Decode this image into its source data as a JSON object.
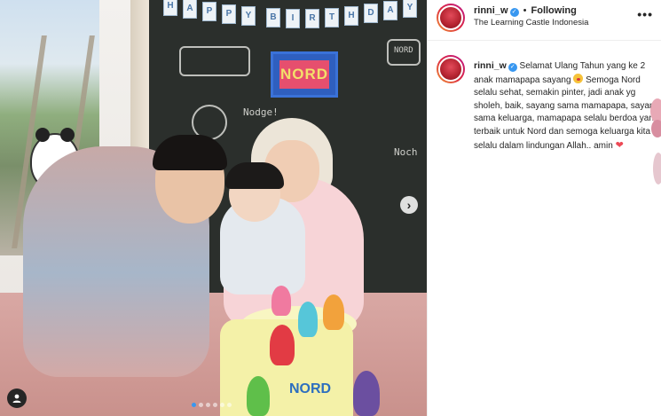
{
  "post": {
    "username": "rinni_w",
    "verified": true,
    "follow_status": "Following",
    "separator": "•",
    "location": "The Learning Castle Indonesia",
    "more_label": "•••"
  },
  "media": {
    "banner_letters": [
      "H",
      "A",
      "P",
      "P",
      "Y",
      "B",
      "I",
      "R",
      "T",
      "H",
      "D",
      "A",
      "Y"
    ],
    "sign_text": "NORD",
    "chalk_words": [
      "Nodge!",
      "NORD",
      "Noch"
    ],
    "cake_text": "NORD",
    "carousel_dots": 6,
    "active_dot": 0,
    "next_icon": "chevron-right-icon",
    "tagged_icon": "person-icon"
  },
  "caption": {
    "username": "rinni_w",
    "text_part1": "Selamat Ulang Tahun yang ke 2 anak mamapapa sayang",
    "text_part2": "Semoga Nord selalu sehat, semakin pinter, jadi anak yg sholeh, baik, sayang sama mamapapa, sayang sama keluarga, mamapapa selalu berdoa yang terbaik untuk Nord dan semoga keluarga kita selalu dalam lindungan Allah.. amin",
    "emoji1": "kissing-face-icon",
    "emoji2": "red-heart-icon",
    "heart": "❤"
  },
  "colors": {
    "verified": "#3897f0",
    "heart": "#ed4956",
    "active_dot": "#3897f0"
  }
}
